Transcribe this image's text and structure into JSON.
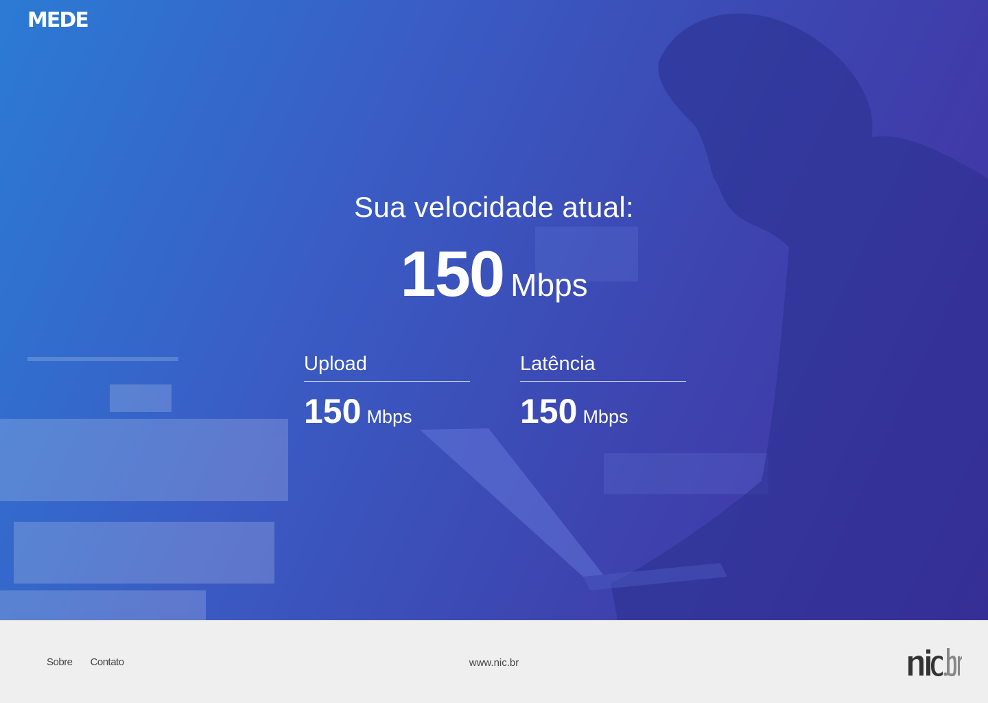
{
  "header": {
    "logo_text": "MEDE"
  },
  "speed": {
    "label": "Sua velocidade atual:",
    "value": "150",
    "unit": "Mbps"
  },
  "metrics": [
    {
      "label": "Upload",
      "value": "150",
      "unit": "Mbps"
    },
    {
      "label": "Latência",
      "value": "150",
      "unit": "Mbps"
    }
  ],
  "footer": {
    "links": [
      {
        "label": "Sobre"
      },
      {
        "label": "Contato"
      }
    ],
    "site": "www.nic.br",
    "brand_logo": "nic.br"
  },
  "colors": {
    "gradient_start": "#2b7bd4",
    "gradient_end": "#432ea0",
    "footer_bg": "#efefef",
    "footer_text": "#444444"
  }
}
